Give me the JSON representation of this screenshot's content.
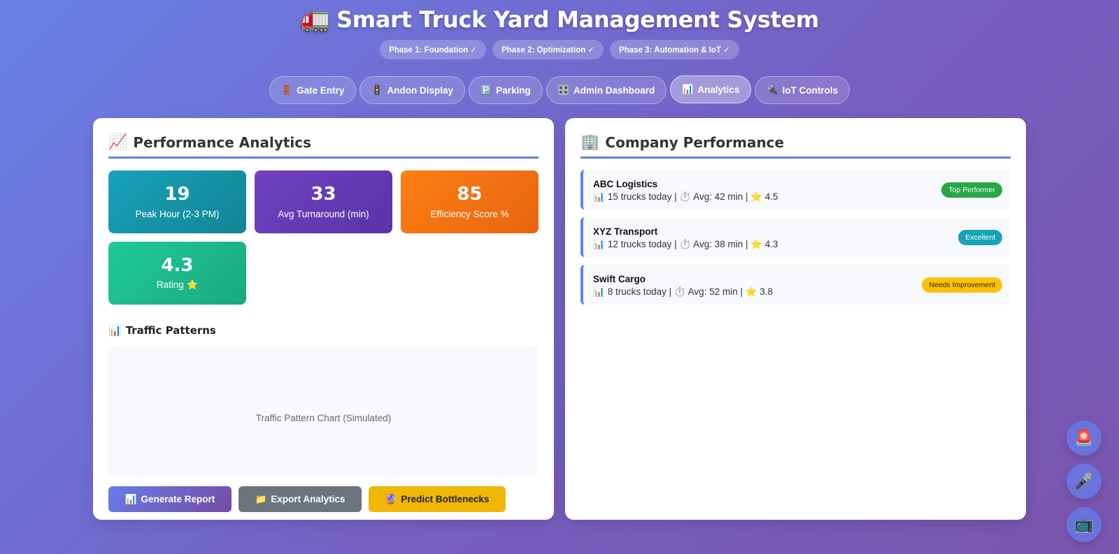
{
  "header": {
    "title_icon": "🚛",
    "title": "Smart Truck Yard Management System",
    "phases": [
      "Phase 1: Foundation ✓",
      "Phase 2: Optimization ✓",
      "Phase 3: Automation & IoT ✓"
    ]
  },
  "nav": {
    "tabs": [
      {
        "icon": "🚪",
        "label": "Gate Entry"
      },
      {
        "icon": "🚦",
        "label": "Andon Display"
      },
      {
        "icon": "🅿️",
        "label": "Parking"
      },
      {
        "icon": "🎛️",
        "label": "Admin Dashboard"
      },
      {
        "icon": "📊",
        "label": "Analytics",
        "active": true
      },
      {
        "icon": "🔌",
        "label": "IoT Controls"
      }
    ]
  },
  "analytics": {
    "title_icon": "📈",
    "title": "Performance Analytics",
    "stats": [
      {
        "value": "19",
        "label": "Peak Hour (2-3 PM)"
      },
      {
        "value": "33",
        "label": "Avg Turnaround (min)"
      },
      {
        "value": "85",
        "label": "Efficiency Score %"
      },
      {
        "value": "4.3",
        "label": "Rating ⭐"
      }
    ],
    "traffic_icon": "📊",
    "traffic_title": "Traffic Patterns",
    "chart_placeholder": "Traffic Pattern Chart (Simulated)",
    "buttons": {
      "generate_icon": "📊",
      "generate": "Generate Report",
      "export_icon": "📁",
      "export": "Export Analytics",
      "predict_icon": "🔮",
      "predict": "Predict Bottlenecks"
    }
  },
  "company_performance": {
    "title_icon": "🏢",
    "title": "Company Performance",
    "companies": [
      {
        "name": "ABC Logistics",
        "meta": "15 trucks today | ⏱️ Avg: 42 min | ⭐ 4.5",
        "badge": "Top Performer"
      },
      {
        "name": "XYZ Transport",
        "meta": "12 trucks today | ⏱️ Avg: 38 min | ⭐ 4.3",
        "badge": "Excellent"
      },
      {
        "name": "Swift Cargo",
        "meta": "8 trucks today | ⏱️ Avg: 52 min | ⭐ 3.8",
        "badge": "Needs Improvement"
      }
    ],
    "meta_icon": "📊"
  },
  "fabs": {
    "emergency": "🚨",
    "voice": "🎤",
    "tv": "📺"
  },
  "colors": {
    "accent": "#667eea",
    "success": "#28a745",
    "info": "#17a2b8",
    "warning": "#ffc107"
  }
}
